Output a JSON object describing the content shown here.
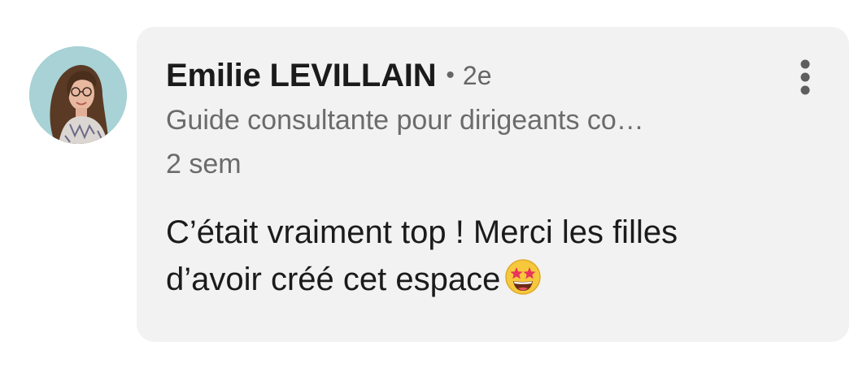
{
  "comment": {
    "author_name": "Emilie LEVILLAIN",
    "separator": "•",
    "connection_degree": "2e",
    "author_headline": "Guide consultante pour dirigeants co…",
    "timestamp": "2 sem",
    "text_line_1": "C’était vraiment top ! Merci les filles",
    "text_line_2": "d’avoir créé cet espace",
    "emoji": "star-struck-emoji-icon",
    "more_options_icon": "more-vertical-icon"
  },
  "colors": {
    "bubble_background": "#f2f2f2",
    "primary_text": "#1b1b1b",
    "secondary_text": "#6b6b6b"
  }
}
